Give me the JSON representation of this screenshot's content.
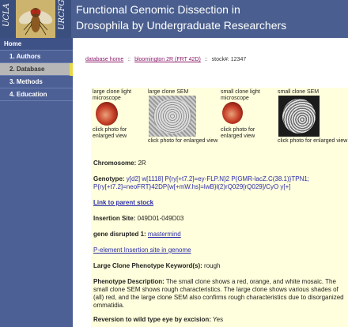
{
  "header": {
    "left_vertical": "UCLA",
    "right_vertical": "URCFG",
    "title_line1": "Functional Genomic Dissection in",
    "title_line2": "Drosophila by Undergraduate Researchers",
    "brand_color": "#4a5f8f"
  },
  "sidebar": {
    "home": "Home",
    "items": [
      {
        "label": "1. Authors"
      },
      {
        "label": "2. Database"
      },
      {
        "label": "3. Methods"
      },
      {
        "label": "4. Education"
      }
    ],
    "active_index": 1
  },
  "breadcrumb": {
    "home_link": "database home",
    "sep": "::",
    "stock_link": "bloomington 2R (FRT 42D)",
    "stock_text": "stock#: 12347"
  },
  "photos": [
    {
      "label": "large clone light microscope",
      "caption": "click photo for enlarged view",
      "icon": "red-eye-image"
    },
    {
      "label": "large clone SEM",
      "caption": "click photo for enlarged view",
      "icon": "sem-eye-image"
    },
    {
      "label": "small clone light microscope",
      "caption": "click photo for enlarged view",
      "icon": "red-eye-image"
    },
    {
      "label": "small clone SEM",
      "caption": "click photo for enlarged view",
      "icon": "sem-eye-image"
    }
  ],
  "details": {
    "chromosome_label": "Chromosome:",
    "chromosome_value": "2R",
    "genotype_label": "Genotype:",
    "genotype_value": "y[d2] w[1118] P{ry[+t7.2]=ey-FLP.N}2 P{GMR-lacZ.C(38.1)}TPN1; P{ry[+t7.2]=neoFRT}42DP{w[+mW.hs]=lwB}l(2)rQ029[rQ029]/CyO y[+]",
    "parent_link": "Link to parent stock",
    "insertion_label": "Insertion Site:",
    "insertion_value": "049D01-049D03",
    "gene_label": "gene disrupted 1:",
    "gene_value": "mastermind",
    "pelement_link": "P-element Insertion site in genome",
    "phenotype_kw_label": "Large Clone Phenotype Keyword(s):",
    "phenotype_kw_value": "rough",
    "phenotype_desc_label": "Phenotype Description:",
    "phenotype_desc_value": "The small clone shows a red, orange, and white mosaic. The small clone SEM shows rough characteristics. The large clone shows various shades of (all) red, and the large clone SEM also confirms rough characteristics due to disorganized ommatidia.",
    "reversion_label": "Reversion to wild type eye by excision:",
    "reversion_value": "Yes"
  }
}
